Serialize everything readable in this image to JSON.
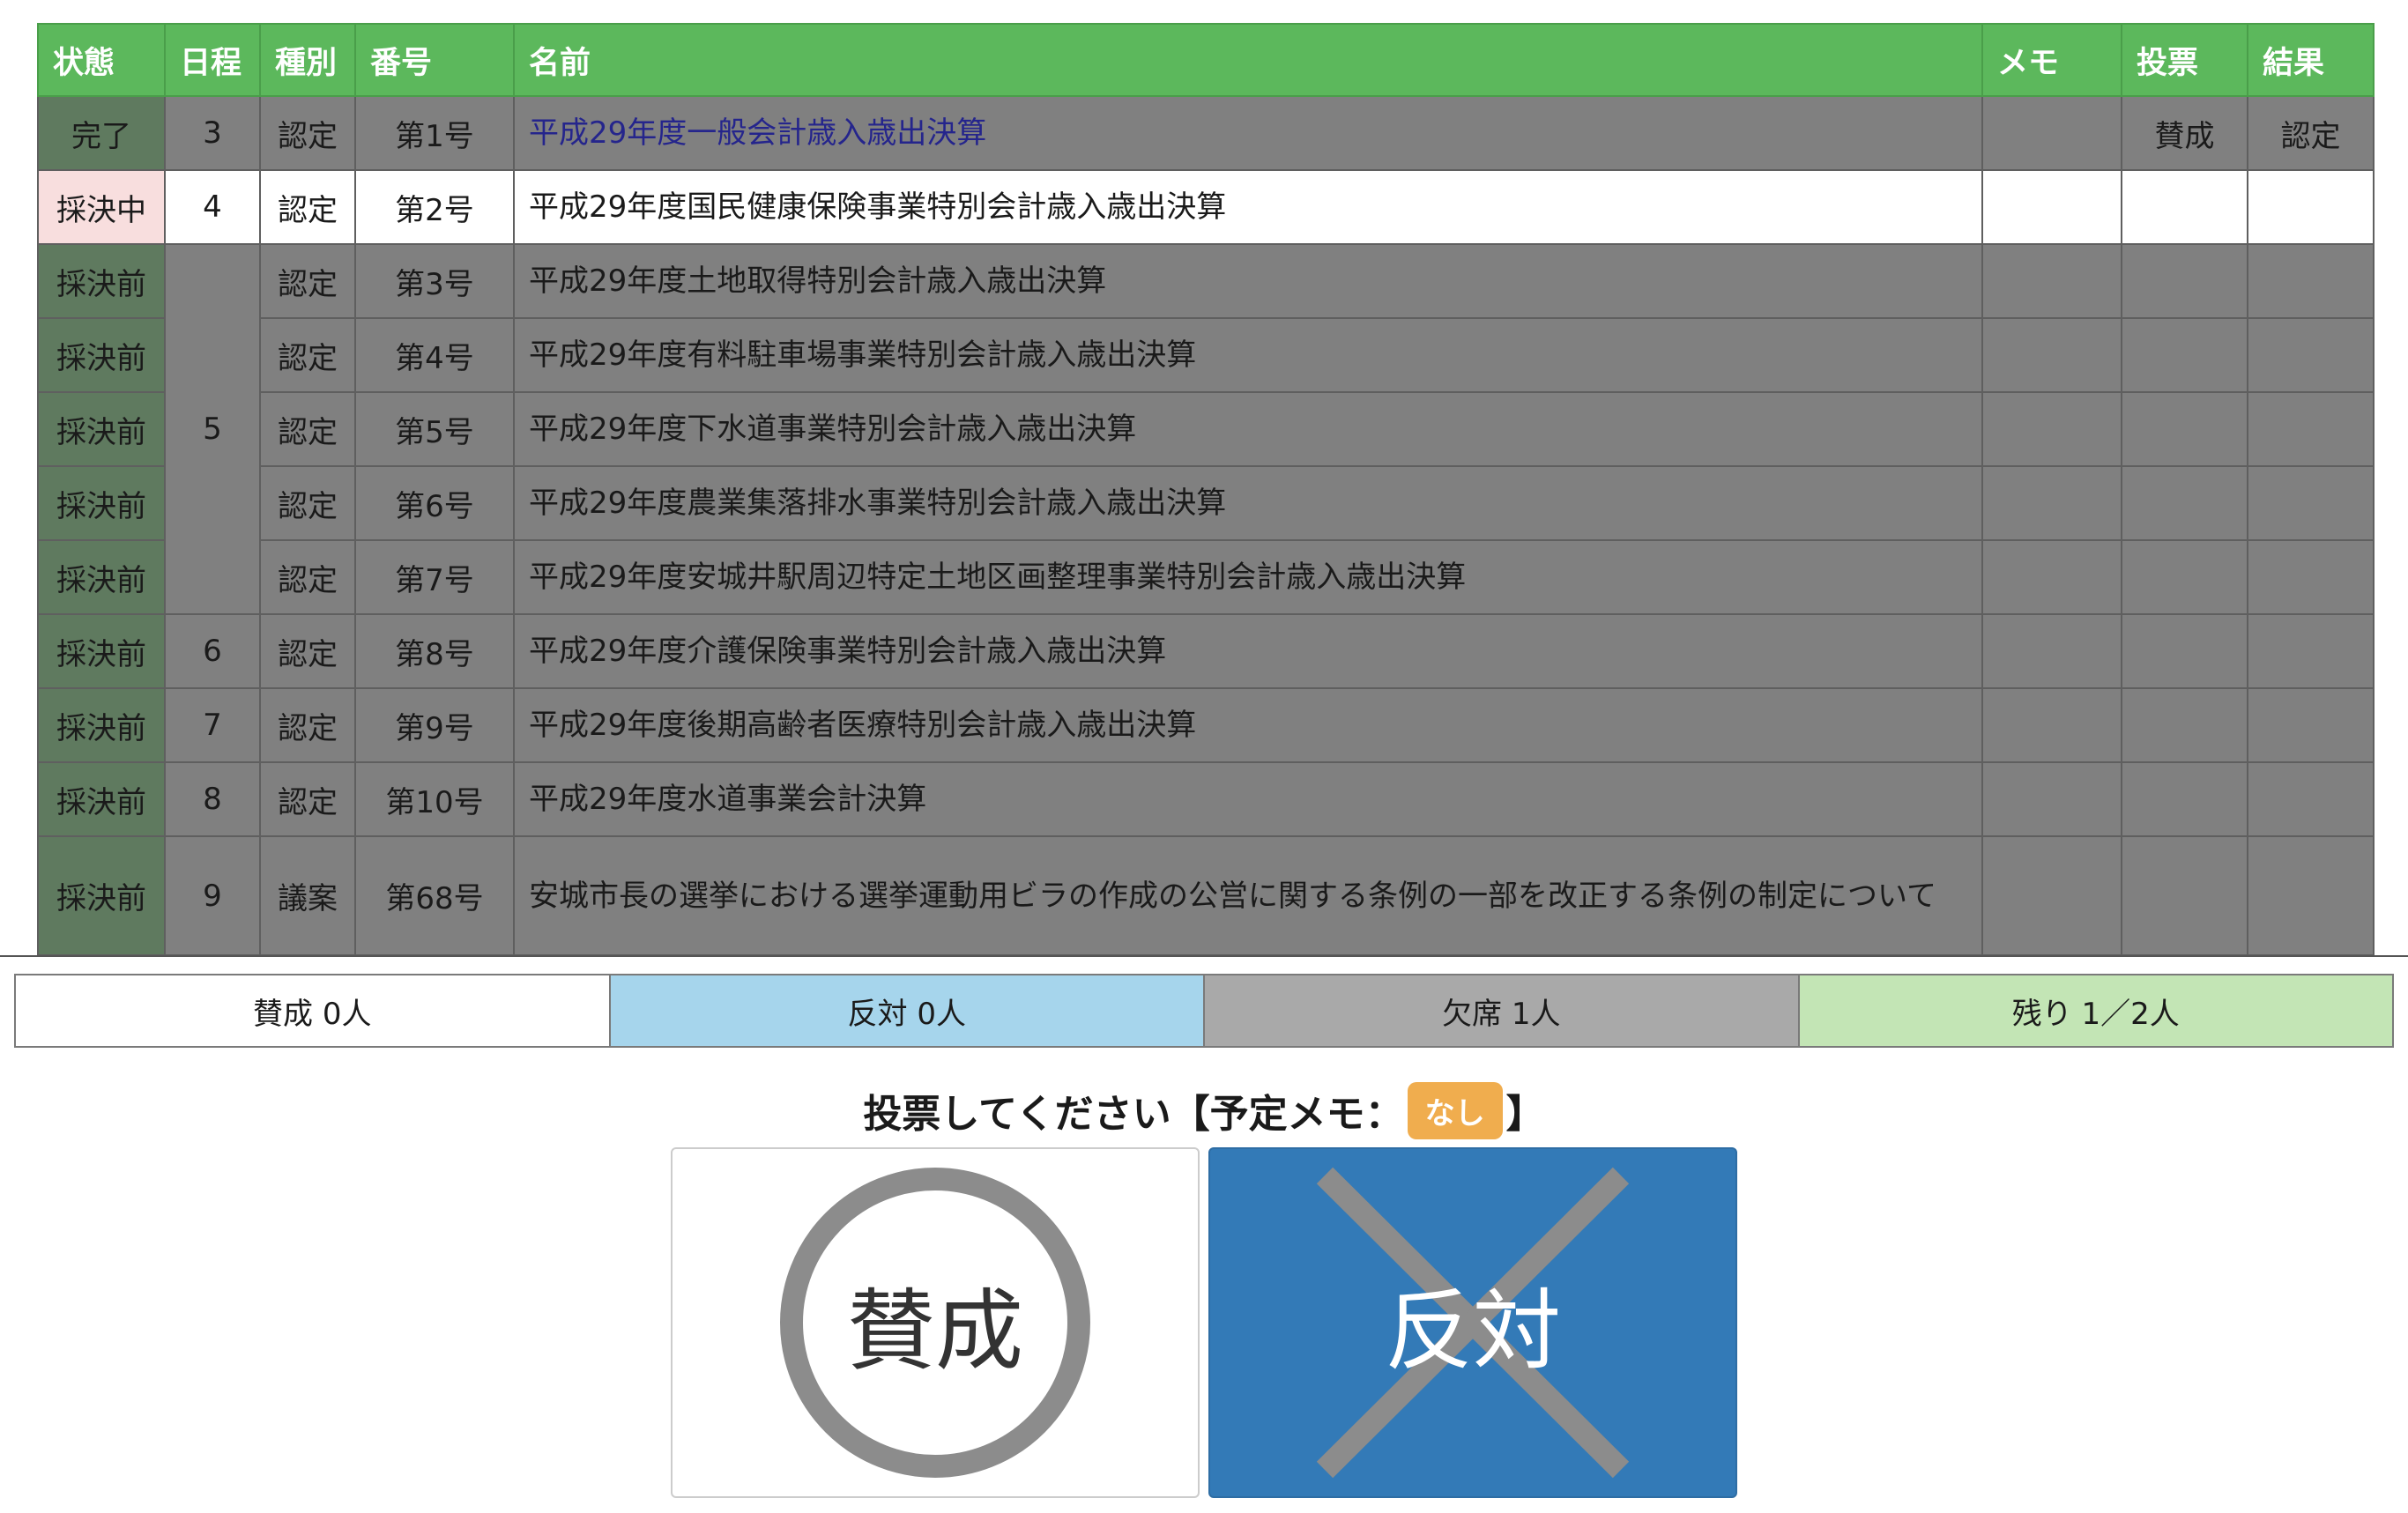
{
  "table": {
    "headers": [
      "状態",
      "日程",
      "種別",
      "番号",
      "名前",
      "メモ",
      "投票",
      "結果"
    ],
    "rows": [
      {
        "status": "完了",
        "day": "3",
        "type": "認定",
        "number": "第1号",
        "name": "平成29年度一般会計歳入歳出決算",
        "memo": "",
        "vote": "賛成",
        "result": "認定"
      },
      {
        "status": "採決中",
        "day": "4",
        "type": "認定",
        "number": "第2号",
        "name": "平成29年度国民健康保険事業特別会計歳入歳出決算",
        "memo": "",
        "vote": "",
        "result": ""
      },
      {
        "status": "採決前",
        "day": "5",
        "type": "認定",
        "number": "第3号",
        "name": "平成29年度土地取得特別会計歳入歳出決算",
        "memo": "",
        "vote": "",
        "result": ""
      },
      {
        "status": "採決前",
        "day": "",
        "type": "認定",
        "number": "第4号",
        "name": "平成29年度有料駐車場事業特別会計歳入歳出決算",
        "memo": "",
        "vote": "",
        "result": ""
      },
      {
        "status": "採決前",
        "day": "",
        "type": "認定",
        "number": "第5号",
        "name": "平成29年度下水道事業特別会計歳入歳出決算",
        "memo": "",
        "vote": "",
        "result": ""
      },
      {
        "status": "採決前",
        "day": "",
        "type": "認定",
        "number": "第6号",
        "name": "平成29年度農業集落排水事業特別会計歳入歳出決算",
        "memo": "",
        "vote": "",
        "result": ""
      },
      {
        "status": "採決前",
        "day": "",
        "type": "認定",
        "number": "第7号",
        "name": "平成29年度安城井駅周辺特定土地区画整理事業特別会計歳入歳出決算",
        "memo": "",
        "vote": "",
        "result": ""
      },
      {
        "status": "採決前",
        "day": "6",
        "type": "認定",
        "number": "第8号",
        "name": "平成29年度介護保険事業特別会計歳入歳出決算",
        "memo": "",
        "vote": "",
        "result": ""
      },
      {
        "status": "採決前",
        "day": "7",
        "type": "認定",
        "number": "第9号",
        "name": "平成29年度後期高齢者医療特別会計歳入歳出決算",
        "memo": "",
        "vote": "",
        "result": ""
      },
      {
        "status": "採決前",
        "day": "8",
        "type": "認定",
        "number": "第10号",
        "name": "平成29年度水道事業会計決算",
        "memo": "",
        "vote": "",
        "result": ""
      },
      {
        "status": "採決前",
        "day": "9",
        "type": "議案",
        "number": "第68号",
        "name": "安城市長の選挙における選挙運動用ビラの作成の公営に関する条例の一部を改正する条例の制定について",
        "memo": "",
        "vote": "",
        "result": ""
      }
    ]
  },
  "tally": {
    "agree": "賛成 0人",
    "oppose": "反対 0人",
    "absent": "欠席 1人",
    "remaining": "残り 1／2人"
  },
  "colors": {
    "header_green": "#5cb85c",
    "row_gray": "#808080",
    "active_row": "#ffffff",
    "active_status": "#f8dede",
    "tally_agree": "#ffffff",
    "tally_oppose": "#a6d5ec",
    "tally_absent": "#a9a9a9",
    "tally_remaining": "#c3e5b5",
    "memo_badge": "#f0ad4e",
    "oppose_button": "#337ab7"
  },
  "prompt": {
    "text": "投票してください【予定メモ：",
    "memo_value": "なし",
    "close": "】"
  },
  "buttons": {
    "agree_label": "賛成",
    "oppose_label": "反対",
    "agree_icon": "circle-icon",
    "oppose_icon": "cross-icon"
  }
}
